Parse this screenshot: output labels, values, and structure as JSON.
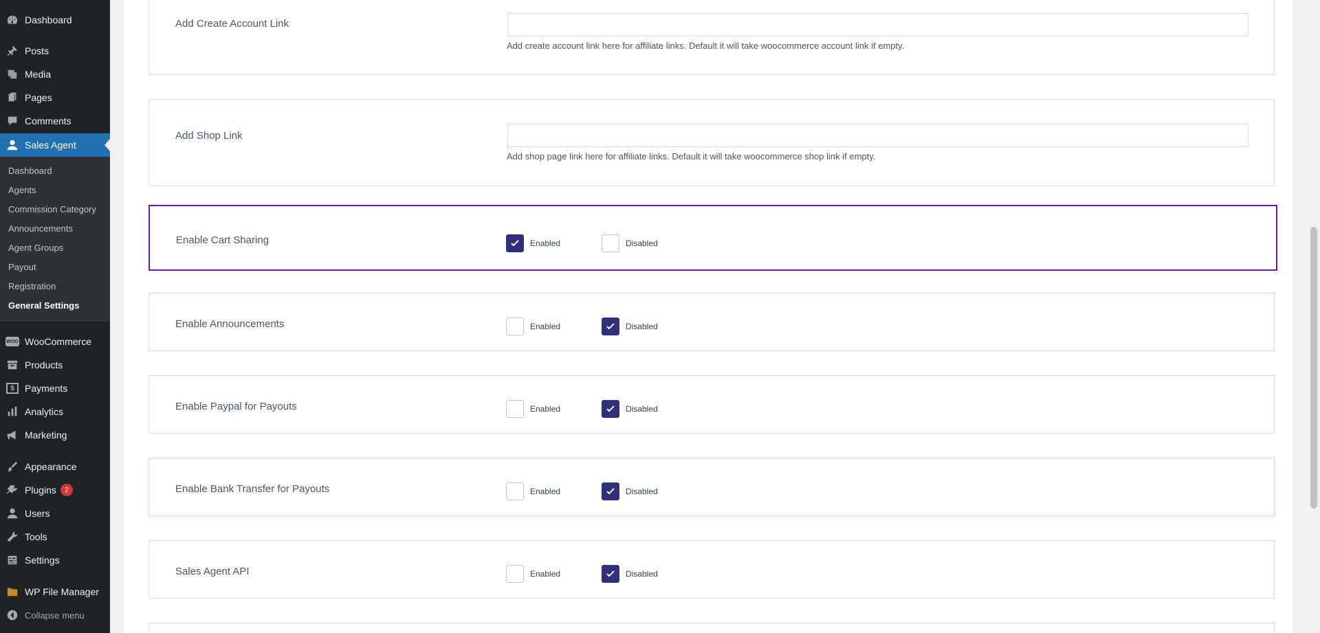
{
  "sidebar": {
    "items": [
      {
        "label": "Dashboard",
        "icon": "dashboard-icon"
      },
      {
        "label": "Posts",
        "icon": "pin-icon"
      },
      {
        "label": "Media",
        "icon": "media-icon"
      },
      {
        "label": "Pages",
        "icon": "pages-icon"
      },
      {
        "label": "Comments",
        "icon": "comments-icon"
      },
      {
        "label": "Sales Agent",
        "icon": "user-icon"
      },
      {
        "label": "WooCommerce",
        "icon": "woocommerce-icon",
        "logo_text": "WOO"
      },
      {
        "label": "Products",
        "icon": "archive-icon"
      },
      {
        "label": "Payments",
        "icon": "dollar-icon",
        "logo_text": "$"
      },
      {
        "label": "Analytics",
        "icon": "chart-icon"
      },
      {
        "label": "Marketing",
        "icon": "megaphone-icon"
      },
      {
        "label": "Appearance",
        "icon": "brush-icon"
      },
      {
        "label": "Plugins",
        "icon": "plugin-icon",
        "badge": "2"
      },
      {
        "label": "Users",
        "icon": "users-icon"
      },
      {
        "label": "Tools",
        "icon": "wrench-icon"
      },
      {
        "label": "Settings",
        "icon": "settings-icon"
      },
      {
        "label": "WP File Manager",
        "icon": "folder-icon"
      },
      {
        "label": "Collapse menu",
        "icon": "collapse-icon"
      }
    ],
    "submenu": [
      "Dashboard",
      "Agents",
      "Commission Category",
      "Announcements",
      "Agent Groups",
      "Payout",
      "Registration",
      "General Settings"
    ]
  },
  "settings": {
    "create_account": {
      "label": "Add Create Account Link",
      "value": "",
      "help": "Add create account link here for affiliate links. Default it will take woocommerce account link if empty."
    },
    "shop_link": {
      "label": "Add Shop Link",
      "value": "",
      "help": "Add shop page link here for affiliate links. Default it will take woocommerce shop link if empty."
    },
    "toggles": [
      {
        "label": "Enable Cart Sharing",
        "enabled_label": "Enabled",
        "disabled_label": "Disabled",
        "selected": "enabled"
      },
      {
        "label": "Enable Announcements",
        "enabled_label": "Enabled",
        "disabled_label": "Disabled",
        "selected": "disabled"
      },
      {
        "label": "Enable Paypal for Payouts",
        "enabled_label": "Enabled",
        "disabled_label": "Disabled",
        "selected": "disabled"
      },
      {
        "label": "Enable Bank Transfer for Payouts",
        "enabled_label": "Enabled",
        "disabled_label": "Disabled",
        "selected": "disabled"
      },
      {
        "label": "Sales Agent API",
        "enabled_label": "Enabled",
        "disabled_label": "Disabled",
        "selected": "disabled"
      }
    ]
  },
  "colors": {
    "sidebar_bg": "#1d2327",
    "accent": "#2271b1",
    "checkbox_checked": "#2f2f7a",
    "focus_border": "#6a1b9a",
    "badge": "#d63638"
  }
}
